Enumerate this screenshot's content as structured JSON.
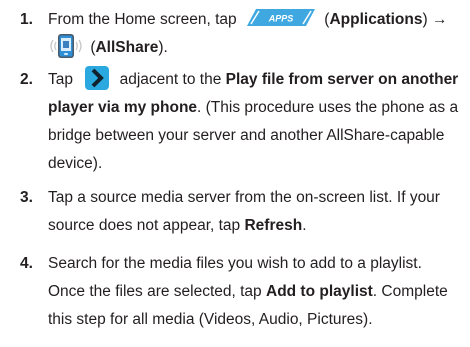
{
  "steps": [
    {
      "number": "1.",
      "line1_pre": "From the Home screen, tap",
      "apps_label": "APPS",
      "line1_post_a": "(",
      "applications": "Applications",
      "line1_post_b": ") →",
      "line2_pre": "(",
      "allshare": "AllShare",
      "line2_post": ")."
    },
    {
      "number": "2.",
      "line1_pre": "Tap",
      "line1_post": "adjacent to the",
      "bold_a": "Play file from server on another",
      "bold_b": "player via my phone",
      "line2_post": ". (This procedure uses the phone as a",
      "line3": "bridge between your server and another AllShare-capable",
      "line4": "device)."
    },
    {
      "number": "3.",
      "line1": "Tap a source media server from the on-screen list. If your",
      "line2_pre": "source does not appear, tap",
      "refresh": "Refresh",
      "line2_post": "."
    },
    {
      "number": "4.",
      "line1": "Search for the media files you wish to add to a playlist.",
      "line2_pre": "Once the files are selected, tap",
      "add_to_playlist": "Add to playlist",
      "line2_post": ". Complete",
      "line3": "this step for all media (Videos, Audio, Pictures)."
    }
  ],
  "colors": {
    "text": "#231f20",
    "apps_button": "#3fa8e0",
    "chevron_button": "#29a9e0"
  },
  "icons": [
    "apps-button-icon",
    "allshare-icon",
    "chevron-right-icon"
  ]
}
